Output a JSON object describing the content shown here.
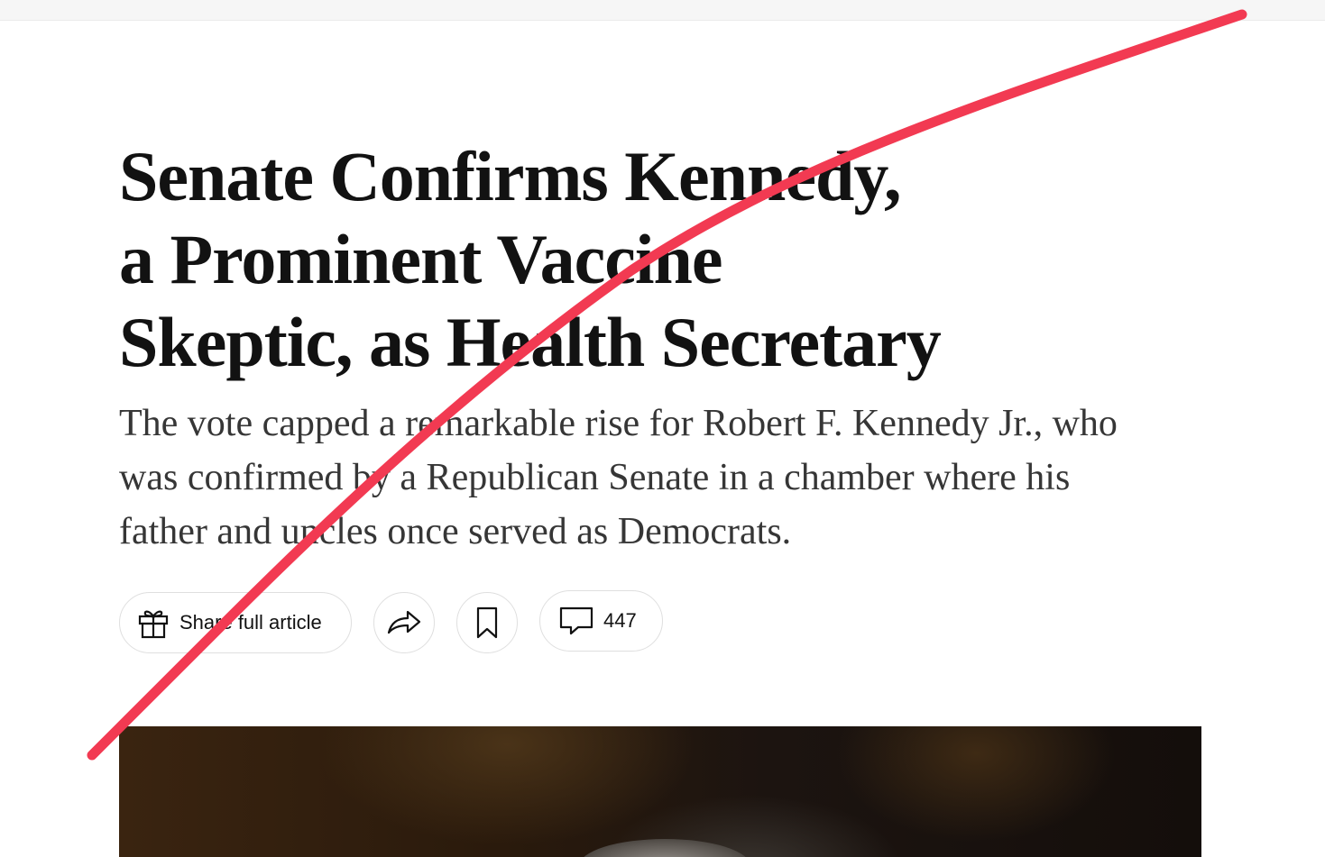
{
  "article": {
    "headline_lines": [
      "Senate Confirms Kennedy,",
      "a Prominent Vaccine",
      "Skeptic, as Health Secretary"
    ],
    "summary_lines": [
      "The vote capped a remarkable rise for Robert F. Kennedy Jr., who",
      "was confirmed by a Republican Senate in a chamber where his",
      "father and uncles once served as Democrats."
    ]
  },
  "actions": {
    "share_full_article": {
      "label": "Share full article",
      "icon": "gift-icon"
    },
    "share": {
      "icon": "share-arrow-icon"
    },
    "save": {
      "icon": "bookmark-icon"
    },
    "comments": {
      "count": "447",
      "icon": "comment-bubble-icon"
    }
  },
  "media": {
    "photo": "lead-photo"
  },
  "colors": {
    "text": "#121212",
    "summary_text": "#363636",
    "pill_border": "#dfdfdf",
    "annotation_stroke": "#f23a52"
  }
}
